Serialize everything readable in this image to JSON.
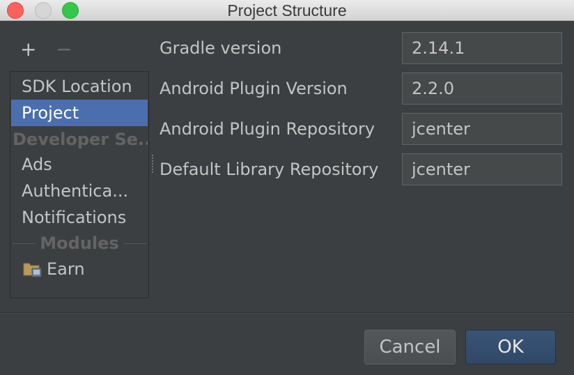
{
  "window": {
    "title": "Project Structure"
  },
  "toolbar": {
    "add_label": "+",
    "remove_label": "−"
  },
  "sidebar": {
    "items": [
      {
        "label": "SDK Location",
        "selected": false
      },
      {
        "label": "Project",
        "selected": true
      }
    ],
    "developer_group_label": "Developer Se...",
    "developer_items": [
      {
        "label": "Ads"
      },
      {
        "label": "Authentica..."
      },
      {
        "label": "Notifications"
      }
    ],
    "modules_label": "Modules",
    "modules": [
      {
        "label": "Earn",
        "icon": "module-folder-icon"
      }
    ]
  },
  "form": {
    "fields": [
      {
        "label": "Gradle version",
        "value": "2.14.1"
      },
      {
        "label": "Android Plugin Version",
        "value": "2.2.0"
      },
      {
        "label": "Android Plugin Repository",
        "value": "jcenter"
      },
      {
        "label": "Default Library Repository",
        "value": "jcenter"
      }
    ]
  },
  "buttons": {
    "cancel_label": "Cancel",
    "ok_label": "OK"
  },
  "colors": {
    "background": "#3c3f41",
    "selection": "#4b6eaf",
    "ok_button": "#34506f"
  }
}
